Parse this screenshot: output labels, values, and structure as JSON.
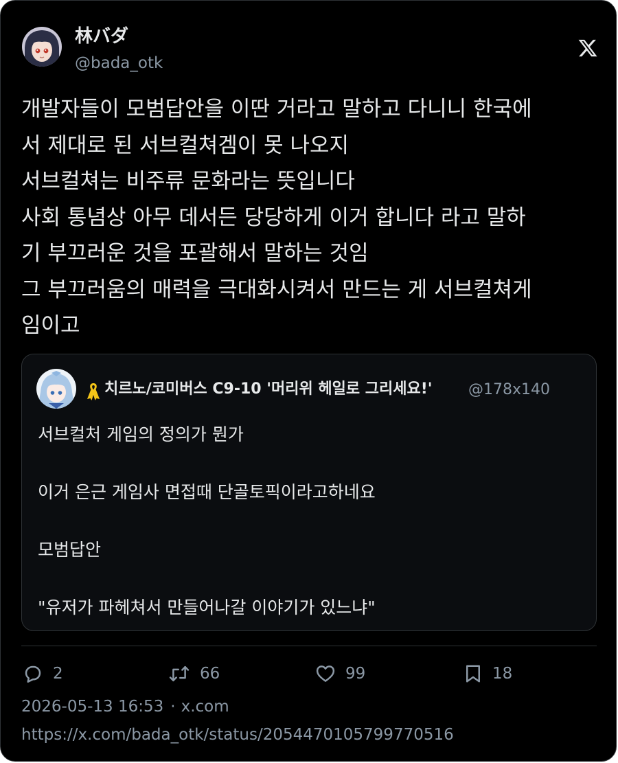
{
  "author": {
    "display_name": "林バダ",
    "handle": "@bada_otk"
  },
  "icons": {
    "platform": "x-logo-icon",
    "reply": "reply-bubble-icon",
    "repost": "repost-icon",
    "like": "heart-icon",
    "bookmark": "bookmark-icon",
    "ribbon": "yellow-ribbon-icon"
  },
  "tweet": {
    "text": "개발자들이 모범답안을 이딴 거라고 말하고 다니니 한국에\n서 제대로 된 서브컬쳐겜이 못 나오지\n서브컬쳐는 비주류 문화라는 뜻입니다\n사회 통념상 아무 데서든 당당하게 이거 합니다 라고 말하\n기 부끄러운 것을 포괄해서 말하는 것임\n그 부끄러움의 매력을 극대화시켜서 만드는 게 서브컬쳐게\n임이고"
  },
  "quote": {
    "display_name": "치르노/코미버스 C9-10 '머리위 헤일로 그리세요!'",
    "handle": "@178x140",
    "paragraphs": [
      "서브컬처 게임의 정의가 뭔가",
      "",
      "이거 은근 게임사 면접때 단골토픽이라고하네요",
      "",
      "모범답안",
      "",
      "\"유저가 파헤쳐서 만들어나갈 이야기가 있느냐\""
    ]
  },
  "stats": {
    "replies": "2",
    "reposts": "66",
    "likes": "99",
    "bookmarks": "18"
  },
  "meta": {
    "timestamp": "2026-05-13 16:53",
    "separator": "·",
    "source": "x.com",
    "url": "https://x.com/bada_otk/status/2054470105799770516"
  },
  "colors": {
    "background": "#000000",
    "text_primary": "#e7e9ea",
    "text_secondary": "#8b98a5",
    "border": "#2f3336",
    "ribbon": "#f5c518"
  }
}
